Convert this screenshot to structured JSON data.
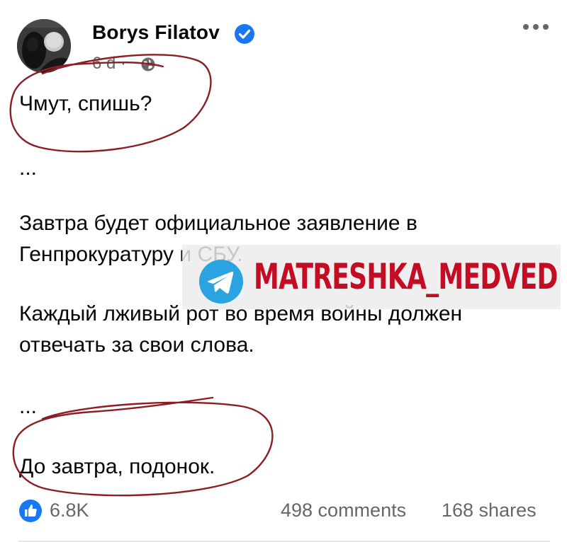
{
  "post": {
    "author": "Borys Filatov",
    "time": "6 d ·",
    "icons": {
      "avatar": "profile-photo",
      "verified": "verified-badge-icon",
      "privacy": "globe-icon",
      "menu": "more-options-icon",
      "reaction": "like-icon"
    },
    "lines": [
      "Чмут, спишь?",
      "...",
      "Завтра будет официальное заявление в",
      "Генпрокуратуру и СБУ.",
      "Каждый лживый рот во время войны должен",
      "отвечать за свои слова.",
      "...",
      "До завтра, подонок."
    ]
  },
  "watermark": {
    "text": "MATRESHKA_MEDVED",
    "icon": "telegram-icon",
    "color": "#c20d24"
  },
  "footer": {
    "reactions": "6.8K",
    "comments": "498 comments",
    "shares": "168 shares"
  },
  "colors": {
    "verified": "#1877f2",
    "secondary_text": "#65676b",
    "annotation": "#8b1d24",
    "telegram": "#2aa3e0"
  }
}
